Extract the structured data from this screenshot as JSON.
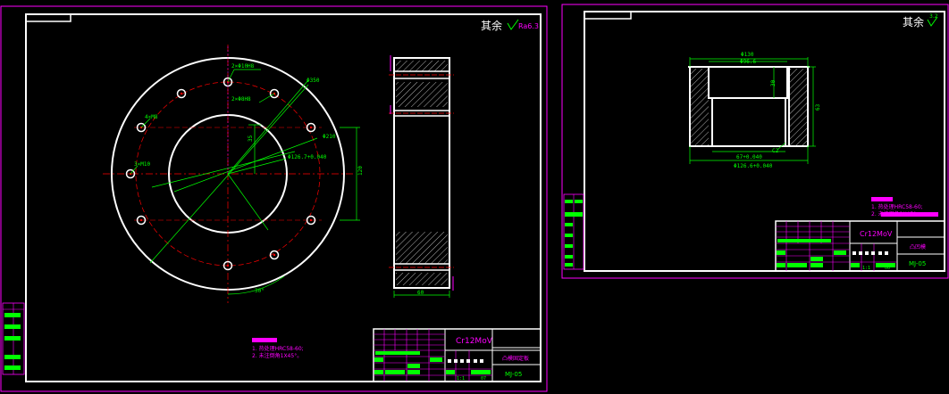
{
  "left_sheet": {
    "roughness_prefix": "其余",
    "roughness_value": "Ra6.3",
    "dims": {
      "bolt_circle": "2×Φ10H8",
      "pin_holes": "2×Φ8H8",
      "tap_holes": "4×M8",
      "screw_holes": "3×M10",
      "outer_dia": "Φ350",
      "bore_dia": "Φ210",
      "bore_fit": "Φ126.7+0.040",
      "center_height": "120",
      "height_small": "35",
      "angle": "30°",
      "width": "60"
    },
    "notes": {
      "title": "技术要求",
      "items": [
        "1. 热处理HRC58-60;",
        "2. 未注倒角1X45°。"
      ]
    },
    "title_block": {
      "material": "Cr12MoV",
      "part_name": "凸模固定板",
      "drawing_no": "MJ-05",
      "scale": "1:1",
      "sheet": "07"
    }
  },
  "right_sheet": {
    "roughness_prefix": "其余",
    "roughness_value": "3.2",
    "dims": {
      "outer_dia": "Φ130",
      "mid_dia": "Φ96.6",
      "bore_dia": "67+0.040",
      "bottom_dia": "Φ126.6+0.040",
      "depth": "30",
      "height": "63",
      "chamfer": "C2"
    },
    "notes": {
      "title": "技术要求",
      "items": [
        "1. 热处理HRC58-60;",
        "2. 未注倒角1X45°。"
      ]
    },
    "title_block": {
      "material": "Cr12MoV",
      "part_name": "凸凹模",
      "drawing_no": "MJ-05",
      "scale": "1:1",
      "sheet": "06"
    }
  },
  "colors": {
    "background": "#000000",
    "frame": "#ff00ff",
    "lines": "#ffffff",
    "dimension": "#00ff00",
    "centerline": "#ff0000",
    "note_block": "#ff00ff"
  }
}
